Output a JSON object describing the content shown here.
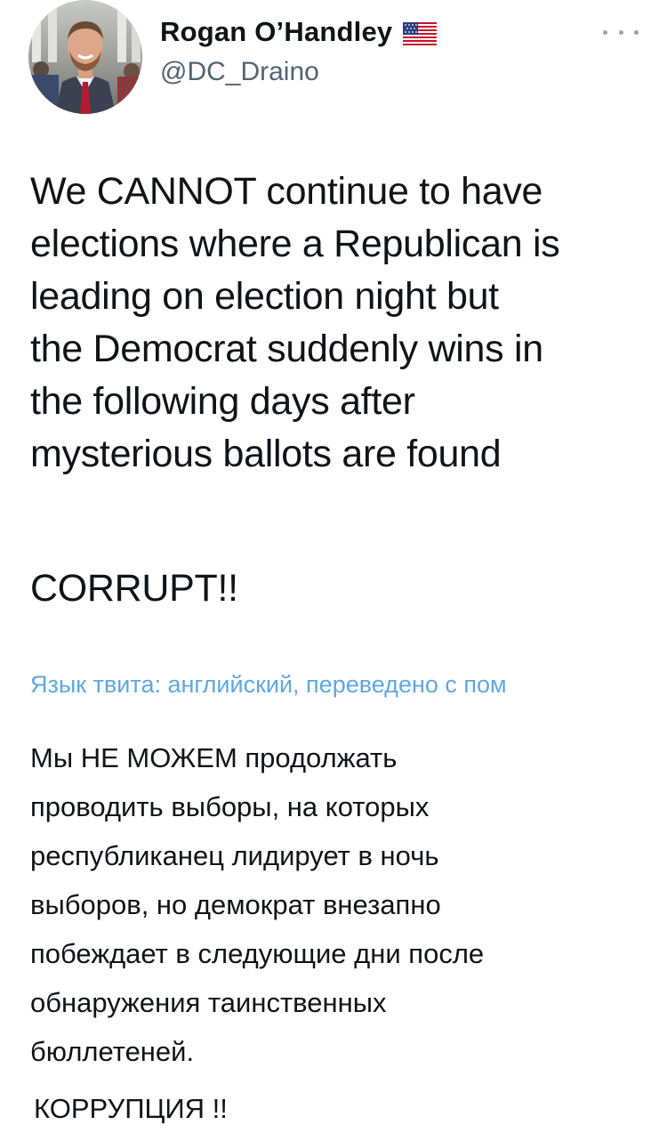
{
  "author": {
    "display_name": "Rogan O’Handley",
    "handle": "@DC_Draino",
    "flag_icon": "us-flag-icon"
  },
  "tweet": {
    "text": "We CANNOT continue to have\nelections where a Republican is\nleading on election night but\nthe Democrat suddenly wins in\nthe following days after\nmysterious ballots are found",
    "text_end": "CORRUPT!!"
  },
  "translation": {
    "link_label": "Язык твита: английский, переведено с пом",
    "text": "Мы НЕ МОЖЕМ продолжать\nпроводить выборы, на которых\nреспубликанец лидирует в ночь\nвыборов, но демократ внезапно\nпобеждает в следующие дни после\nобнаружения таинственных\nбюллетеней.",
    "text_end": "КОРРУПЦИЯ !!"
  },
  "colors": {
    "link": "#5fa8e0",
    "secondary_text": "#536471",
    "primary_text": "#0f1419"
  }
}
